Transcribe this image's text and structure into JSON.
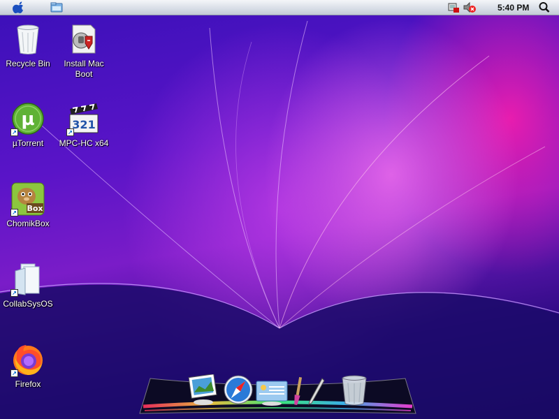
{
  "menubar": {
    "apple_icon": "apple-logo-icon",
    "finder_icon": "finder-folder-icon",
    "clock": "5:40 PM",
    "tray_icons": [
      "network-icon",
      "volume-muted-icon",
      "search-icon"
    ]
  },
  "desktop": {
    "icons": [
      {
        "label": "Recycle Bin",
        "icon": "recycle-bin-icon"
      },
      {
        "label": "Install Mac",
        "label2": "Boot",
        "icon": "install-mac-boot-icon"
      },
      {
        "label": "µTorrent",
        "icon": "utorrent-icon"
      },
      {
        "label": "MPC-HC x64",
        "icon": "mpc-hc-icon"
      },
      {
        "label": "ChomikBox",
        "icon": "chomikbox-icon"
      },
      {
        "label": "CollabSysOS",
        "icon": "folder-icon"
      },
      {
        "label": "Firefox",
        "icon": "firefox-icon"
      }
    ],
    "chomikbox_badge": "Box",
    "mpc_badge": "321"
  },
  "dock": {
    "items": [
      "preview-icon",
      "safari-compass-icon",
      "mail-icon",
      "brush-icon",
      "pen-icon",
      "trash-icon"
    ]
  },
  "colors": {
    "accent_pink": "#ff2aa8",
    "wallpaper_purple": "#5a14c8",
    "menubar": "#d7dde6"
  }
}
